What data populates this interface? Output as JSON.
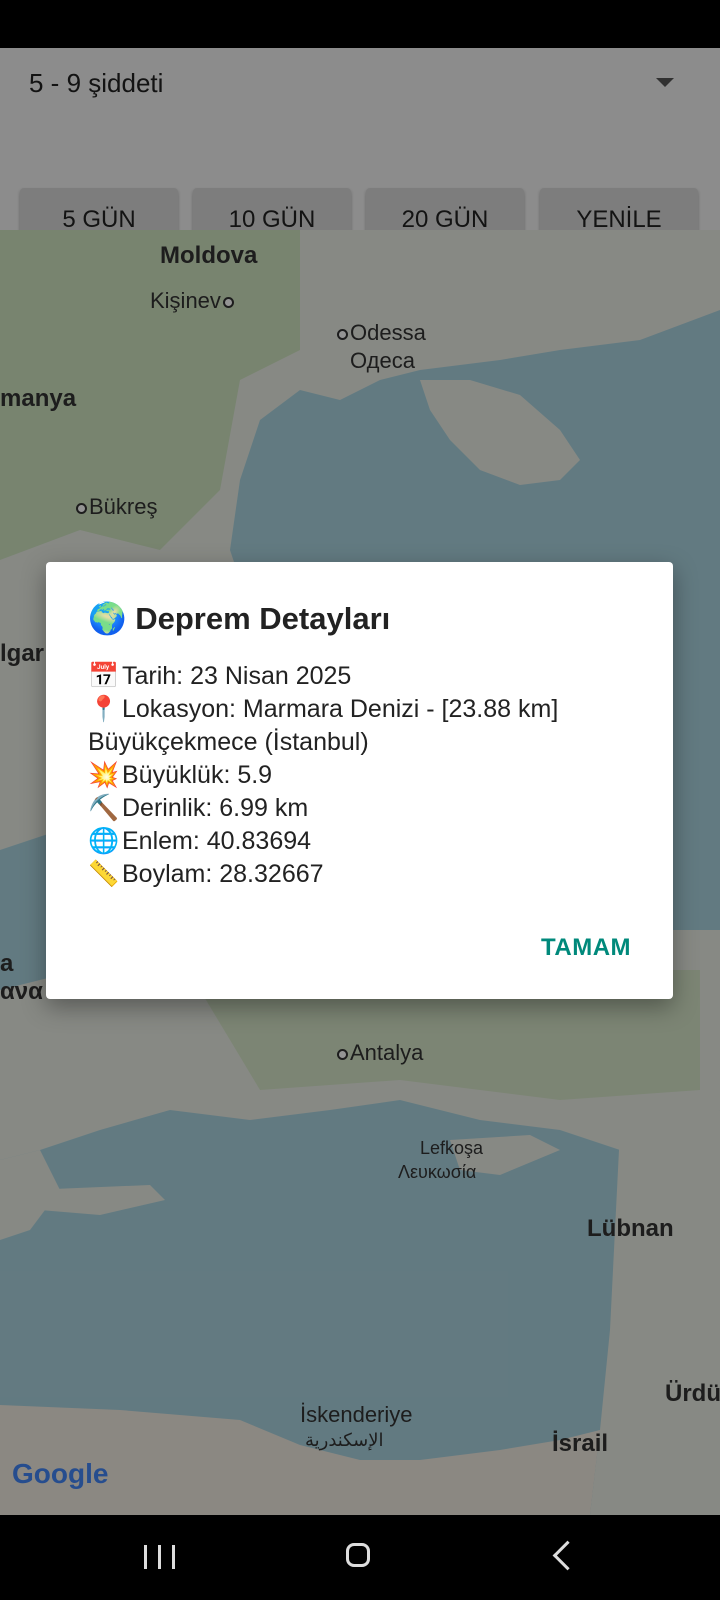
{
  "filter": {
    "selected": "5 - 9 şiddeti"
  },
  "buttons": {
    "b5": "5 GÜN",
    "b10": "10 GÜN",
    "b20": "20 GÜN",
    "refresh": "YENİLE"
  },
  "map": {
    "labels": {
      "moldova": "Moldova",
      "kisinev": "Kişinev",
      "odessa": "Odessa",
      "odessa_cyr": "Одеса",
      "romanya": "manya",
      "bukres": "Bükreş",
      "bulgar": "lgar",
      "greece_a": "a",
      "greece_b": "ανα",
      "antalya": "Antalya",
      "lefkosa": "Lefkoşa",
      "lefkosa_gr": "Λευκωσία",
      "lubnan": "Lübnan",
      "urdun": "Ürdü",
      "iskenderiye": "İskenderiye",
      "iskenderiye_ar": "الإسكندرية",
      "israil": "İsrail"
    },
    "attribution": "Google",
    "colors": {
      "sea": "#aad3df",
      "land": "#e8ede4",
      "green": "#cfe3c0"
    }
  },
  "dialog": {
    "title_emoji": "🌍",
    "title": "Deprem Detayları",
    "lines": [
      {
        "icon": "📅",
        "text": "Tarih: 23 Nisan 2025"
      },
      {
        "icon": "📍",
        "text": "Lokasyon: Marmara Denizi - [23.88 km] Büyükçekmece (İstanbul)"
      },
      {
        "icon": "💥",
        "text": "Büyüklük: 5.9"
      },
      {
        "icon": "⛏️",
        "text": "Derinlik: 6.99 km"
      },
      {
        "icon": "🌐",
        "text": "Enlem: 40.83694"
      },
      {
        "icon": "📏",
        "text": "Boylam: 28.32667"
      }
    ],
    "ok": "TAMAM",
    "ok_color": "#00897b"
  }
}
